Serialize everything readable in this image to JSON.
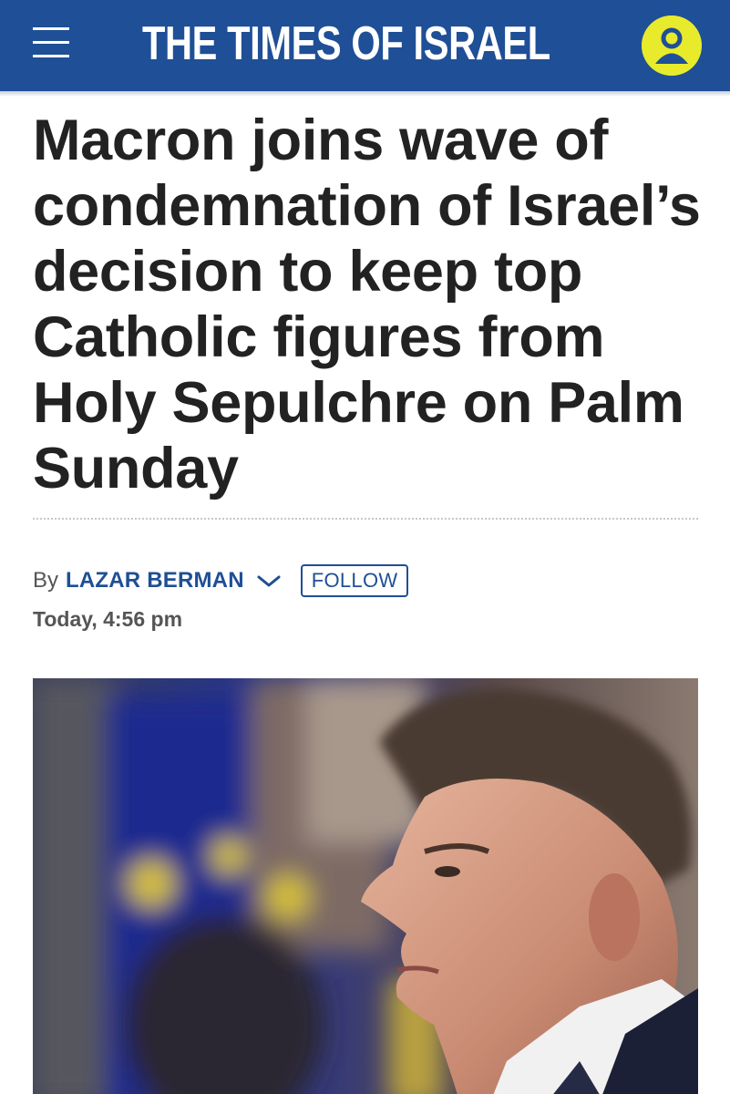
{
  "header": {
    "site_title": "THE TIMES OF ISRAEL",
    "brand_color": "#1f4f96",
    "account_color": "#e8eb2b"
  },
  "article": {
    "headline": "Macron joins wave of condemnation of Israel’s decision to keep top Catholic figures from Holy Sepulchre on Palm Sunday",
    "byline_prefix": "By",
    "author": "LAZAR BERMAN",
    "follow_label": "FOLLOW",
    "timestamp": "Today, 4:56 pm"
  },
  "icons": {
    "menu": "hamburger-menu-icon",
    "account": "user-account-icon",
    "author_menu": "chevron-down-icon"
  }
}
